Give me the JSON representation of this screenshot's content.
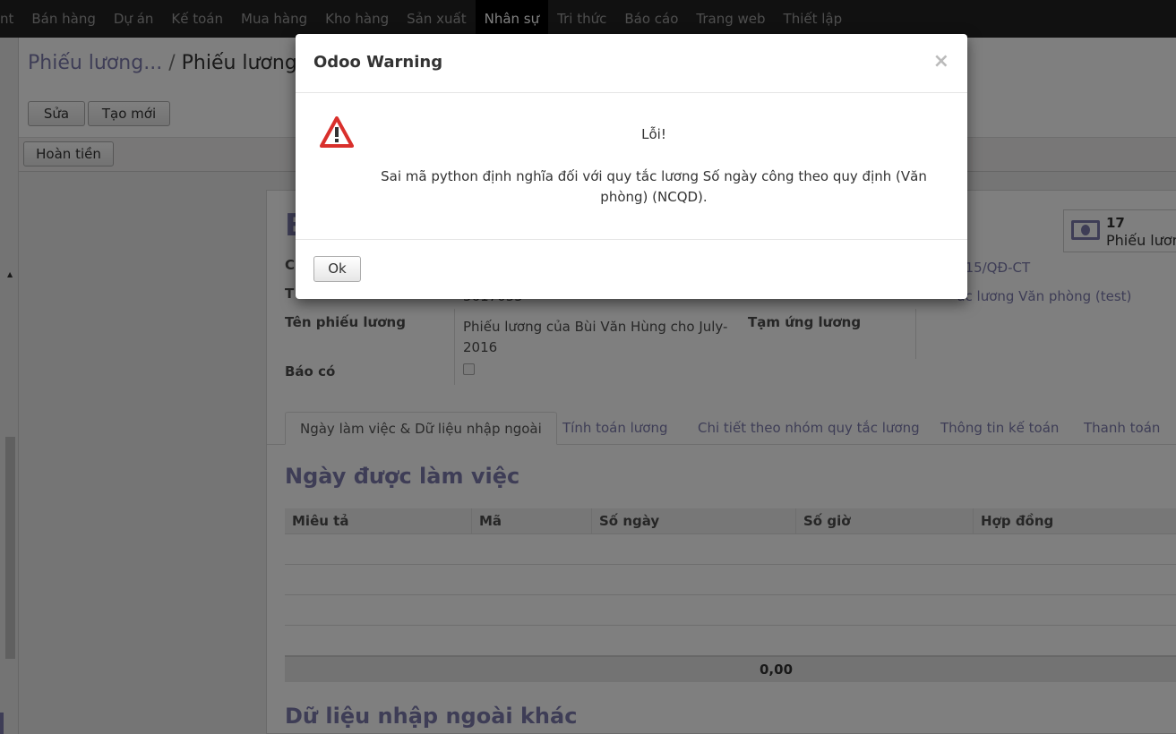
{
  "topnav": {
    "items": [
      "nt",
      "Bán hàng",
      "Dự án",
      "Kế toán",
      "Mua hàng",
      "Kho hàng",
      "Sản xuất",
      "Nhân sự",
      "Tri thức",
      "Báo cáo",
      "Trang web",
      "Thiết lập"
    ],
    "active_index": 7
  },
  "breadcrumb": {
    "parent": "Phiếu lương...",
    "separator": "/",
    "current": "Phiếu lương"
  },
  "toolbar": {
    "edit_label": "Sửa",
    "create_label": "Tạo mới",
    "refund_label": "Hoàn tiền"
  },
  "form": {
    "title_initial": "B",
    "stat_count": "17",
    "stat_label": "Phiếu lươn",
    "label_c": "C",
    "label_t": "T",
    "partial_value": "5617055",
    "ref_value": "015/QĐ-CT",
    "structure_value": "ức lương Văn phòng (test)",
    "payslip_name_label": "Tên phiếu lương",
    "payslip_name_value": "Phiếu lương của Bùi Văn Hùng cho July-2016",
    "advance_label": "Tạm ứng lương",
    "credit_note_label": "Báo có",
    "credit_note_checked": false
  },
  "tabs": [
    "Ngày làm việc & Dữ liệu nhập ngoài",
    "Tính toán lương",
    "Chi tiết theo nhóm quy tắc lương",
    "Thông tin kế toán",
    "Thanh toán"
  ],
  "worked_days": {
    "title": "Ngày được làm việc",
    "columns": [
      "Miêu tả",
      "Mã",
      "Số ngày",
      "Số giờ",
      "Hợp đồng"
    ],
    "total": "0,00"
  },
  "other_inputs_title": "Dữ liệu nhập ngoài khác",
  "modal": {
    "title": "Odoo Warning",
    "close": "×",
    "error_title": "Lỗi!",
    "error_message": "Sai mã python định nghĩa đối với quy tắc lương Số ngày công theo quy định (Văn phòng) (NCQD).",
    "ok_label": "Ok",
    "icon": "warning-triangle-icon"
  }
}
